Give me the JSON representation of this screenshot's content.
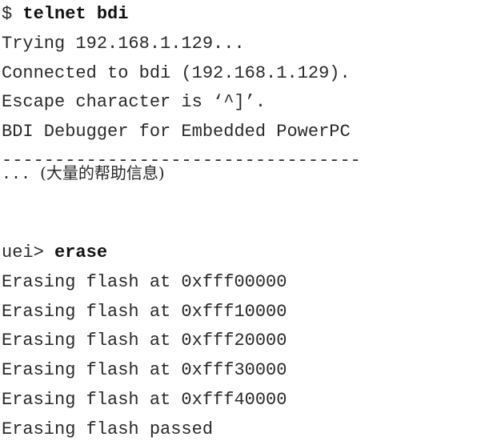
{
  "session": {
    "prompt1": "$ ",
    "command1": "telnet bdi",
    "output1": [
      "Trying 192.168.1.129...",
      "Connected to bdi (192.168.1.129).",
      "Escape character is ‘^]’.",
      "BDI Debugger for Embedded PowerPC"
    ],
    "separator": "----------------------------------",
    "help_note_dots": "... ",
    "help_note_text": "(大量的帮助信息)",
    "prompt2": "uei> ",
    "command2": "erase",
    "output2": [
      "Erasing flash at 0xfff00000",
      "Erasing flash at 0xfff10000",
      "Erasing flash at 0xfff20000",
      "Erasing flash at 0xfff30000",
      "Erasing flash at 0xfff40000",
      "Erasing flash passed"
    ]
  }
}
